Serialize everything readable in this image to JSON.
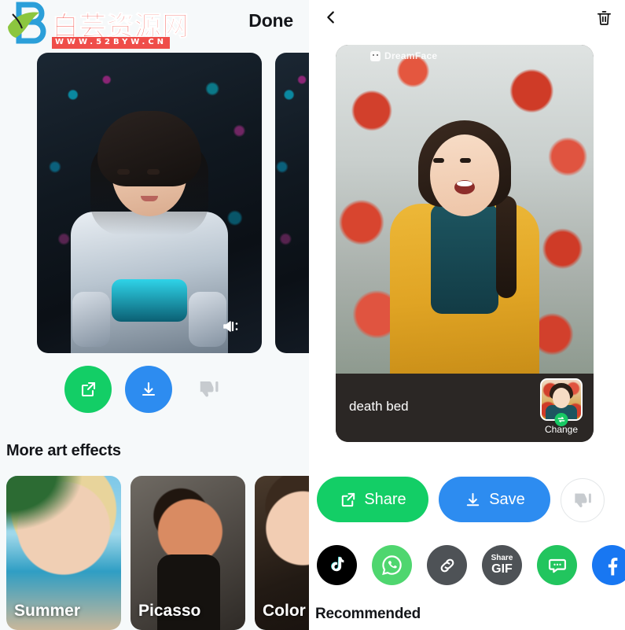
{
  "left_panel": {
    "back_icon": "chevron-left-icon",
    "done_label": "Done",
    "mute_icon": "speaker-mute-icon",
    "actions": [
      {
        "name": "share",
        "icon": "share-box-arrow-icon",
        "color": "#13ce66"
      },
      {
        "name": "save",
        "icon": "download-icon",
        "color": "#2d8cf0"
      },
      {
        "name": "dislike",
        "icon": "thumbs-down-icon",
        "color": "#c7cbcf"
      }
    ],
    "more_art_effects_title": "More art effects",
    "effects": [
      {
        "label": "Summer"
      },
      {
        "label": "Picasso"
      },
      {
        "label": "Color"
      }
    ]
  },
  "watermark": {
    "title": "白芸资源网",
    "url": "WWW.52BYW.CN",
    "brand_color": "#ef4d49"
  },
  "right_panel": {
    "back_icon": "chevron-left-icon",
    "delete_icon": "trash-icon",
    "preview": {
      "app_watermark": "DreamFace",
      "badge_icon": "dreamface-smiley-icon",
      "title": "death bed",
      "change_label": "Change",
      "swap_icon": "swap-arrows-icon"
    },
    "main_actions": {
      "share_label": "Share",
      "share_icon": "share-box-arrow-icon",
      "share_color": "#13ce66",
      "save_label": "Save",
      "save_icon": "download-icon",
      "save_color": "#2d8cf0",
      "dislike_icon": "thumbs-down-icon"
    },
    "social": [
      {
        "name": "tiktok",
        "icon": "tiktok-icon",
        "color": "#000000"
      },
      {
        "name": "whatsapp",
        "icon": "whatsapp-icon",
        "color": "#4fd66f"
      },
      {
        "name": "copylink",
        "icon": "link-icon",
        "color": "#4e5256"
      },
      {
        "name": "sharegif",
        "icon": "share-gif-icon",
        "color": "#4e5256",
        "label_top": "Share",
        "label_bottom": "GIF"
      },
      {
        "name": "message",
        "icon": "message-icon",
        "color": "#22c55e"
      },
      {
        "name": "facebook",
        "icon": "facebook-icon",
        "color": "#1877f2"
      }
    ],
    "recommended_title": "Recommended"
  }
}
